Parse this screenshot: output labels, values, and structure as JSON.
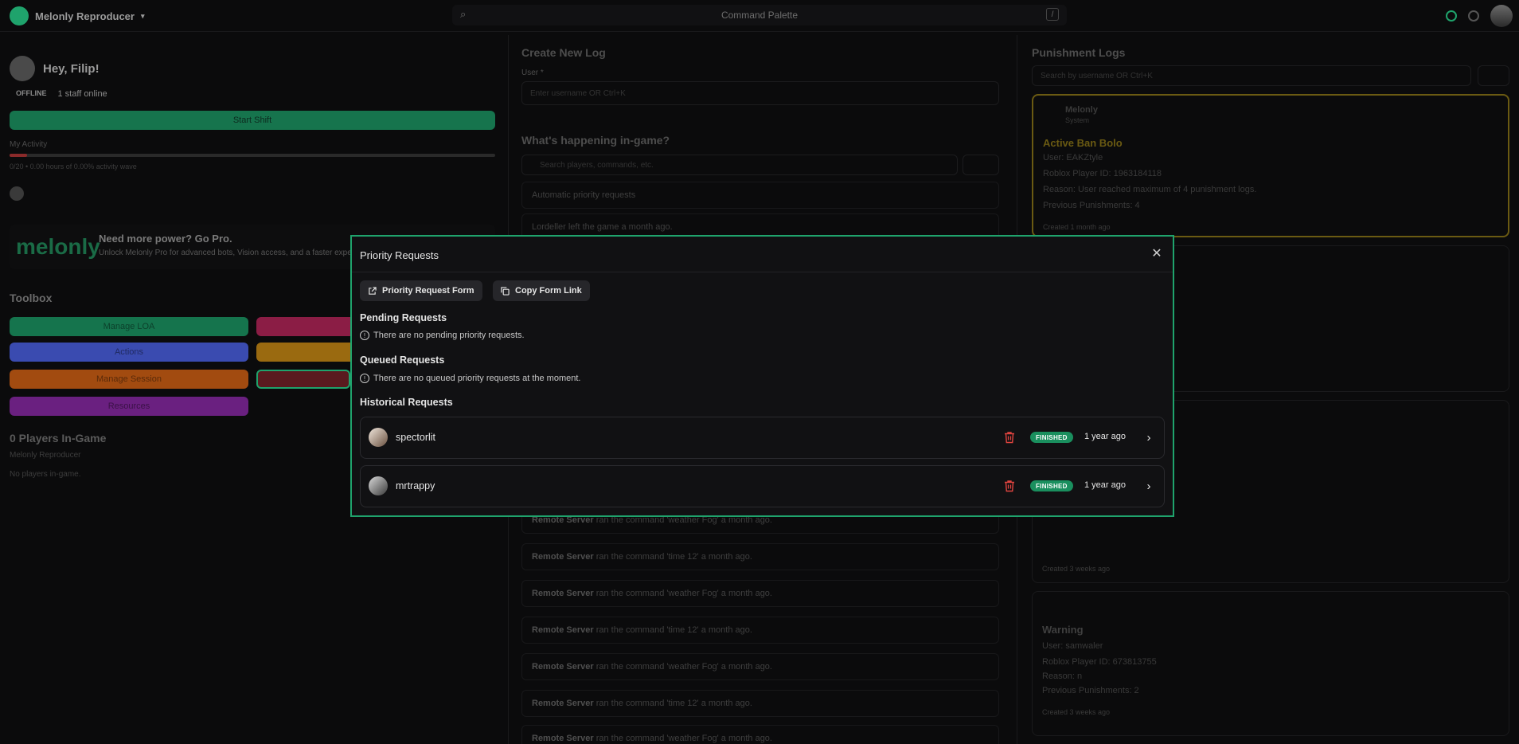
{
  "app": {
    "name": "Melonly Reproducer",
    "command_palette": "Command Palette",
    "command_shortcut": "/"
  },
  "left": {
    "greeting": "Hey, Filip!",
    "status": "OFFLINE",
    "staff_online": "1 staff online",
    "start_shift": "Start Shift",
    "activity_label": "My Activity",
    "activity_sub": "0/20 • 0.00 hours of 0.00% activity wave",
    "promo_logo": "melonly",
    "promo_title": "Need more power? Go Pro.",
    "promo_sub": "Unlock Melonly Pro for advanced bots, Vision access, and a faster experience",
    "toolbox_title": "Toolbox",
    "toolbox": [
      {
        "label": "Manage LOA",
        "color": "#15744d"
      },
      {
        "label": "",
        "color": "#8b1d45"
      },
      {
        "label": "Actions",
        "color": "#3a4bb0"
      },
      {
        "label": "",
        "color": "#9a6a10"
      },
      {
        "label": "Manage Session",
        "color": "#a24b10"
      },
      {
        "label": "",
        "color": "#6a1a1f"
      },
      {
        "label": "Resources",
        "color": "#6a2080"
      }
    ],
    "players_title": "0 Players In-Game",
    "players_server": "Melonly Reproducer",
    "players_none": "No players in-game."
  },
  "middle": {
    "title": "Create New Log",
    "user_label": "User *",
    "user_placeholder": "Enter username OR Ctrl+K",
    "feed_title": "What's happening in-game?",
    "feed_search": "Search players, commands, etc.",
    "feed_top": [
      "Automatic priority requests",
      "Lordeller left the game a month ago."
    ],
    "feed": [
      {
        "actor": "Remote Server",
        "text": " ran the command 'weather Fog' a month ago."
      },
      {
        "actor": "Remote Server",
        "text": " ran the command 'time 12' a month ago."
      },
      {
        "actor": "Remote Server",
        "text": " ran the command 'weather Fog' a month ago."
      },
      {
        "actor": "Remote Server",
        "text": " ran the command 'time 12' a month ago."
      },
      {
        "actor": "Remote Server",
        "text": " ran the command 'weather Fog' a month ago."
      },
      {
        "actor": "Remote Server",
        "text": " ran the command 'time 12' a month ago."
      },
      {
        "actor": "Remote Server",
        "text": " ran the command 'weather Fog' a month ago."
      }
    ]
  },
  "right": {
    "title": "Punishment Logs",
    "search_placeholder": "Search by username OR Ctrl+K",
    "card1": {
      "author": "Melonly",
      "author_sub": "System",
      "type": "Active Ban Bolo",
      "user_label": "User:",
      "user": "EAKZtyle",
      "roblox_id": "Roblox Player ID: 1963184118",
      "reason": "Reason: User reached maximum of 4 punishment logs.",
      "previous": "Previous Punishments: 4",
      "created": "Created 1 month ago"
    },
    "card2_created": "Created 3 weeks ago",
    "card3": {
      "type": "Warning",
      "user_label": "User:",
      "user": "samwaler",
      "roblox_id": "Roblox Player ID: 673813755",
      "reason": "Reason: n",
      "previous": "Previous Punishments: 2",
      "created": "Created 3 weeks ago"
    }
  },
  "modal": {
    "title": "Priority Requests",
    "buttons": {
      "form": "Priority Request Form",
      "copy": "Copy Form Link"
    },
    "pending": {
      "heading": "Pending Requests",
      "empty": "There are no pending priority requests."
    },
    "queued": {
      "heading": "Queued Requests",
      "empty": "There are no queued priority requests at the moment."
    },
    "historical": {
      "heading": "Historical Requests",
      "items": [
        {
          "name": "spectorlit",
          "status": "FINISHED",
          "time": "1 year ago"
        },
        {
          "name": "mrtrappy",
          "status": "FINISHED",
          "time": "1 year ago"
        }
      ]
    }
  },
  "colors": {
    "accent": "#1fa36c",
    "badge": "#1a8f5e",
    "danger": "#e0443f"
  }
}
